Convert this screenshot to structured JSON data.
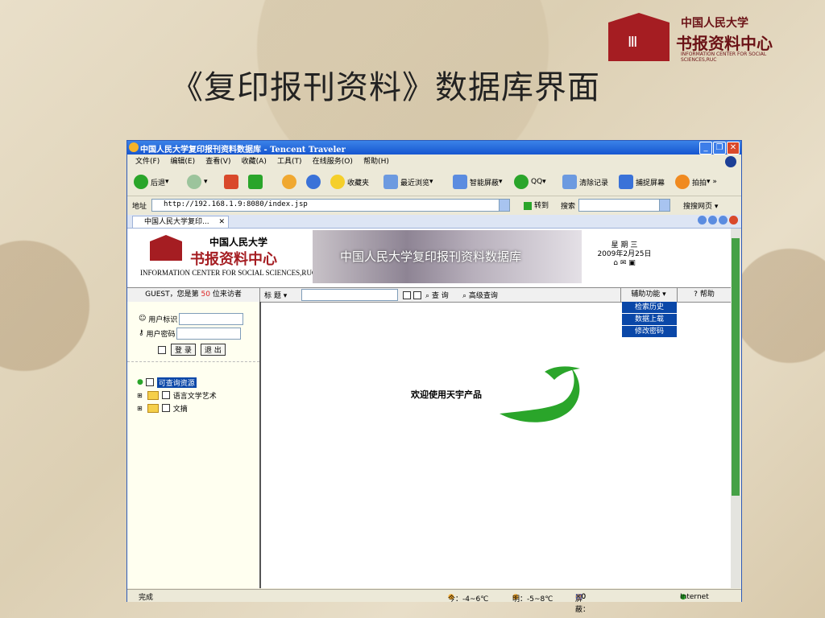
{
  "slide": {
    "title": "《复印报刊资料》数据库界面",
    "brand_cn": "中国人民大学",
    "brand_cn2": "书报资料中心",
    "brand_en": "INFORMATION CENTER FOR SOCIAL SCIENCES,RUC"
  },
  "window": {
    "title": "中国人民大学复印报刊资料数据库 - Tencent Traveler",
    "menu": [
      "文件(F)",
      "编辑(E)",
      "查看(V)",
      "收藏(A)",
      "工具(T)",
      "在线服务(O)",
      "帮助(H)"
    ],
    "toolbar": {
      "back": "后退",
      "favorites": "收藏夹",
      "recent": "最近浏览",
      "smart_block": "智能屏蔽",
      "qq": "QQ",
      "clear": "清除记录",
      "capture": "捕捉屏幕",
      "paipai": "拍拍"
    },
    "address": {
      "label": "地址",
      "url": "http://192.168.1.9:8080/index.jsp",
      "go": "转到",
      "search_label": "搜索",
      "search_web": "搜搜网页"
    },
    "tab_label": "中国人民大学复印...",
    "status": {
      "done": "完成",
      "today": "今：-4~6℃",
      "tomorrow": "明：-5~8℃",
      "block_label": "屏蔽：",
      "block_a": "×0",
      "block_b": "×0",
      "zone": "Internet"
    }
  },
  "page": {
    "logo_cn1": "中国人民大学",
    "logo_cn2": "书报资料中心",
    "logo_en": "INFORMATION CENTER FOR SOCIAL SCIENCES,RUC",
    "banner_title": "中国人民大学复印报刊资料数据库",
    "weekday": "星 期 三",
    "date": "2009年2月25日",
    "guest_prefix": "GUEST，您是第",
    "visitor_no": "50",
    "guest_suffix": "位来访者",
    "field": "标 题",
    "query": "查 询",
    "advanced": "高级查询",
    "aux": "辅助功能",
    "help": "帮助",
    "aux_items": [
      "检索历史",
      "数据上载",
      "修改密码"
    ],
    "user_label": "用户标识",
    "pwd_label": "用户密码",
    "login_btn": "登 录",
    "logout_btn": "退 出",
    "tree": {
      "root": "可查询资源",
      "children": [
        "语言文学艺术",
        "文摘"
      ]
    },
    "welcome": "欢迎使用天宇产品"
  },
  "colors": {
    "accent_red": "#a51d22",
    "select_blue": "#0a47a8",
    "logo_green": "#2aa52a"
  }
}
